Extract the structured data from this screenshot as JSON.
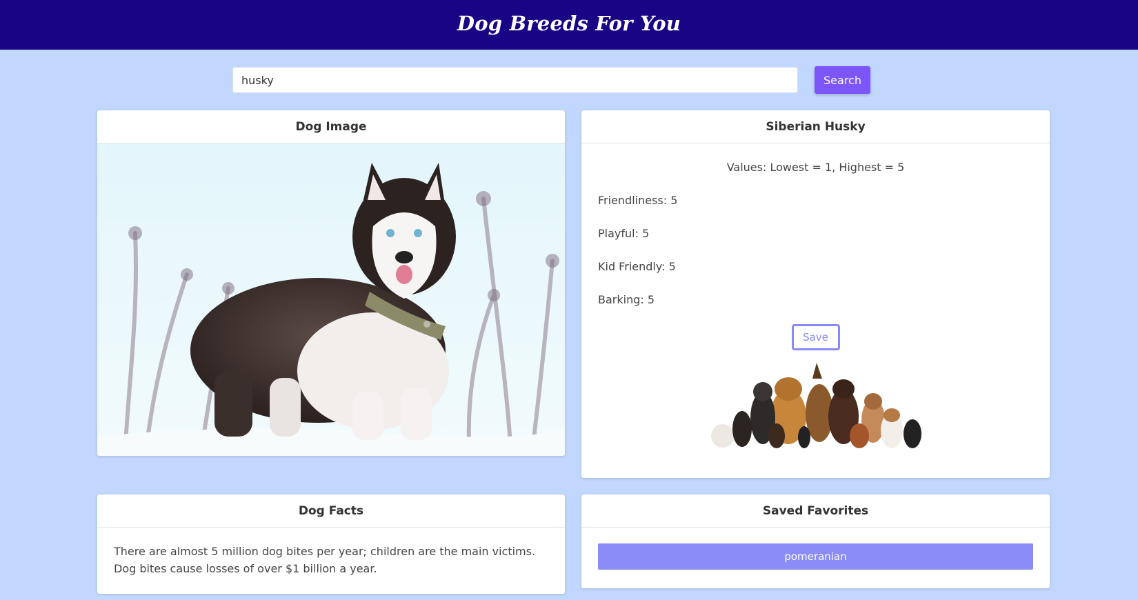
{
  "header": {
    "title": "Dog Breeds For You"
  },
  "search": {
    "value": "husky",
    "button_label": "Search"
  },
  "image_card": {
    "title": "Dog Image"
  },
  "breed_card": {
    "title": "Siberian Husky",
    "values_note": "Values: Lowest = 1, Highest = 5",
    "stats": [
      {
        "label": "Friendliness: 5"
      },
      {
        "label": "Playful: 5"
      },
      {
        "label": "Kid Friendly: 5"
      },
      {
        "label": "Barking: 5"
      }
    ],
    "save_label": "Save"
  },
  "facts_card": {
    "title": "Dog Facts",
    "text": "There are almost 5 million dog bites per year; children are the main victims. Dog bites cause losses of over $1 billion a year."
  },
  "saved_card": {
    "title": "Saved Favorites",
    "items": [
      {
        "label": "pomeranian"
      }
    ]
  },
  "colors": {
    "header_bg": "#1a0486",
    "page_bg": "#c1d7fd",
    "search_button": "#7c55fb",
    "accent": "#8b8cf7"
  }
}
